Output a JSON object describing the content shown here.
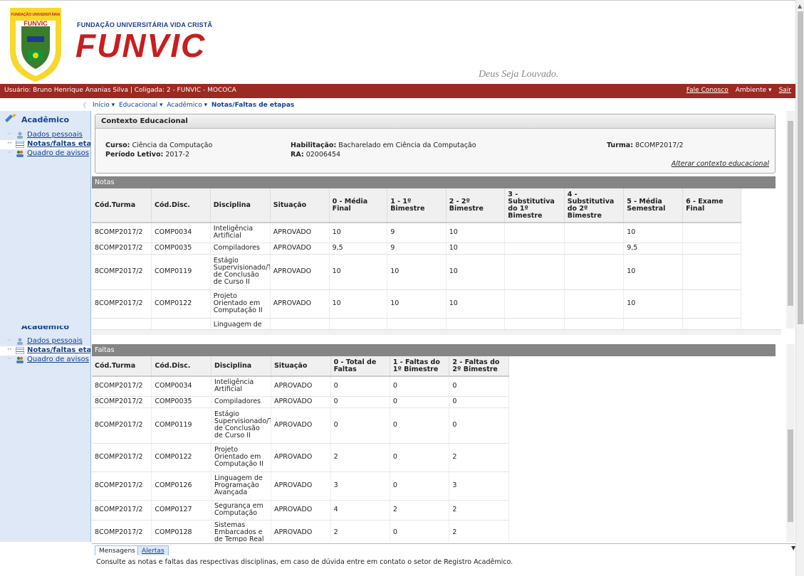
{
  "header": {
    "logo_text": "FUNDAÇÃO UNIVERSITÁRIA VIDA CRISTÃ FUNVIC",
    "inst_name": "FUNDAÇÃO UNIVERSITÁRIA VIDA CRISTÃ",
    "brand": "FUNVIC",
    "motto": "Deus Seja Louvado."
  },
  "topbar": {
    "user": "Usuário: Bruno Henrique Ananias Silva  |  Coligada: 2 - FUNVIC - MOCOCA",
    "contact": "Fale Conosco",
    "ambiente": "Ambiente ▾",
    "exit": "Sair"
  },
  "sidebar": {
    "title": "Acadêmico",
    "title_clipped": "Acadêmico",
    "items": [
      {
        "label": "Dados pessoais"
      },
      {
        "label": "Notas/faltas etap"
      },
      {
        "label": "Quadro de avisos"
      }
    ]
  },
  "breadcrumb": {
    "collapse": "《",
    "items": [
      "Início ▾",
      "Educacional ▾",
      "Acadêmico ▾"
    ],
    "current": "Notas/Faltas de etapas"
  },
  "context": {
    "title": "Contexto Educacional",
    "curso_label": "Curso:",
    "curso": "Ciência da Computação",
    "periodo_label": "Período Letivo:",
    "periodo": "2017-2",
    "habil_label": "Habilitação:",
    "habil": "Bacharelado em Ciência da Computação",
    "ra_label": "RA:",
    "ra": "02006454",
    "turma_label": "Turma:",
    "turma": "8COMP2017/2",
    "change_link": "Alterar contexto educacional"
  },
  "notas": {
    "title": "Notas",
    "headers": [
      "Cód.Turma",
      "Cód.Disc.",
      "Disciplina",
      "Situação",
      "0 - Média Final",
      "1 - 1º Bimestre",
      "2 - 2º Bimestre",
      "3 - Substitutiva do 1º Bimestre",
      "4 - Substitutiva do 2º Bimestre",
      "5 - Média Semestral",
      "6 - Exame Final"
    ],
    "rows": [
      [
        "8COMP2017/2",
        "COMP0034",
        "Inteligência Artificial",
        "APROVADO",
        "10",
        "9",
        "10",
        "",
        "",
        "10",
        ""
      ],
      [
        "8COMP2017/2",
        "COMP0035",
        "Compiladores",
        "APROVADO",
        "9,5",
        "9",
        "10",
        "",
        "",
        "9,5",
        ""
      ],
      [
        "8COMP2017/2",
        "COMP0119",
        "Estágio Supervisionado/T de Conclusão de Curso II",
        "APROVADO",
        "10",
        "10",
        "10",
        "",
        "",
        "10",
        ""
      ],
      [
        "8COMP2017/2",
        "COMP0122",
        "Projeto Orientado em Computação II",
        "APROVADO",
        "10",
        "10",
        "10",
        "",
        "",
        "10",
        ""
      ],
      [
        "",
        "",
        "Linguagem de",
        "",
        "",
        "",
        "",
        "",
        "",
        "",
        ""
      ]
    ]
  },
  "faltas": {
    "title": "Faltas",
    "headers": [
      "Cód.Turma",
      "Cód.Disc.",
      "Disciplina",
      "Situação",
      "0 - Total de Faltas",
      "1 - Faltas do 1º Bimestre",
      "2 - Faltas do 2º Bimestre"
    ],
    "rows": [
      [
        "8COMP2017/2",
        "COMP0034",
        "Inteligência Artificial",
        "APROVADO",
        "0",
        "0",
        "0"
      ],
      [
        "8COMP2017/2",
        "COMP0035",
        "Compiladores",
        "APROVADO",
        "0",
        "0",
        "0"
      ],
      [
        "8COMP2017/2",
        "COMP0119",
        "Estágio Supervisionado/T de Conclusão de Curso II",
        "APROVADO",
        "0",
        "0",
        "0"
      ],
      [
        "8COMP2017/2",
        "COMP0122",
        "Projeto Orientado em Computação II",
        "APROVADO",
        "2",
        "0",
        "2"
      ],
      [
        "8COMP2017/2",
        "COMP0126",
        "Linguagem de Programação Avançada",
        "APROVADO",
        "3",
        "0",
        "3"
      ],
      [
        "8COMP2017/2",
        "COMP0127",
        "Segurança em Computação",
        "APROVADO",
        "4",
        "2",
        "2"
      ],
      [
        "8COMP2017/2",
        "COMP0128",
        "Sistemas Embarcados e de Tempo Real",
        "APROVADO",
        "2",
        "0",
        "2"
      ]
    ]
  },
  "messages": {
    "tab_active": "Mensagens",
    "tab_inactive": "Alertas",
    "text": "Consulte as notas e faltas das respectivas disciplinas, em caso de dúvida entre em contato o setor de Registro Acadêmico."
  },
  "colors": {
    "topbar": "#9b2a22",
    "brand_red": "#c81e1e",
    "brand_blue": "#1e3b8a",
    "panel_header": "#858585",
    "link_blue": "#15428b"
  }
}
